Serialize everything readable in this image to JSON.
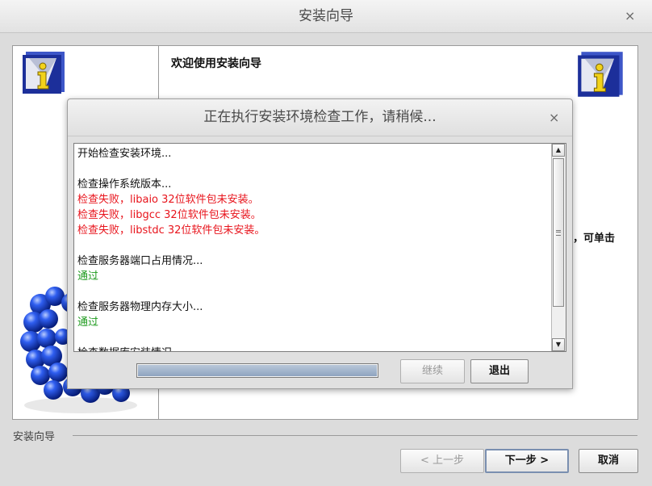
{
  "window": {
    "title": "安装向导",
    "close_glyph": "×"
  },
  "welcome": {
    "heading": "欢迎使用安装向导",
    "partial_text": "，可单击"
  },
  "footer": {
    "group_label": "安装向导",
    "prev_label": "< 上一步",
    "next_label": "下一步 >",
    "cancel_label": "取消"
  },
  "dialog": {
    "title": "正在执行安装环境检查工作，请稍候...",
    "close_glyph": "×",
    "log_lines": [
      {
        "text": "开始检查安装环境...",
        "color": "black"
      },
      {
        "text": "",
        "color": "black"
      },
      {
        "text": "检查操作系统版本...",
        "color": "black"
      },
      {
        "text": "检查失败，libaio 32位软件包未安装。",
        "color": "red"
      },
      {
        "text": "检查失败，libgcc 32位软件包未安装。",
        "color": "red"
      },
      {
        "text": "检查失败，libstdc 32位软件包未安装。",
        "color": "red"
      },
      {
        "text": "",
        "color": "black"
      },
      {
        "text": "检查服务器端口占用情况...",
        "color": "black"
      },
      {
        "text": "通过",
        "color": "green"
      },
      {
        "text": "",
        "color": "black"
      },
      {
        "text": "检查服务器物理内存大小...",
        "color": "black"
      },
      {
        "text": "通过",
        "color": "green"
      },
      {
        "text": "",
        "color": "black"
      },
      {
        "text": "检查数据库安装情况",
        "color": "black"
      }
    ],
    "progress": 1.0,
    "continue_label": "继续",
    "exit_label": "退出"
  },
  "colors": {
    "error": "#e8141c",
    "success": "#1e9a1e",
    "progress": "#8ea4c0"
  },
  "icons": [
    "info-icon",
    "molecule-graphic",
    "close-icon",
    "scroll-up-arrow-icon",
    "scroll-down-arrow-icon"
  ]
}
